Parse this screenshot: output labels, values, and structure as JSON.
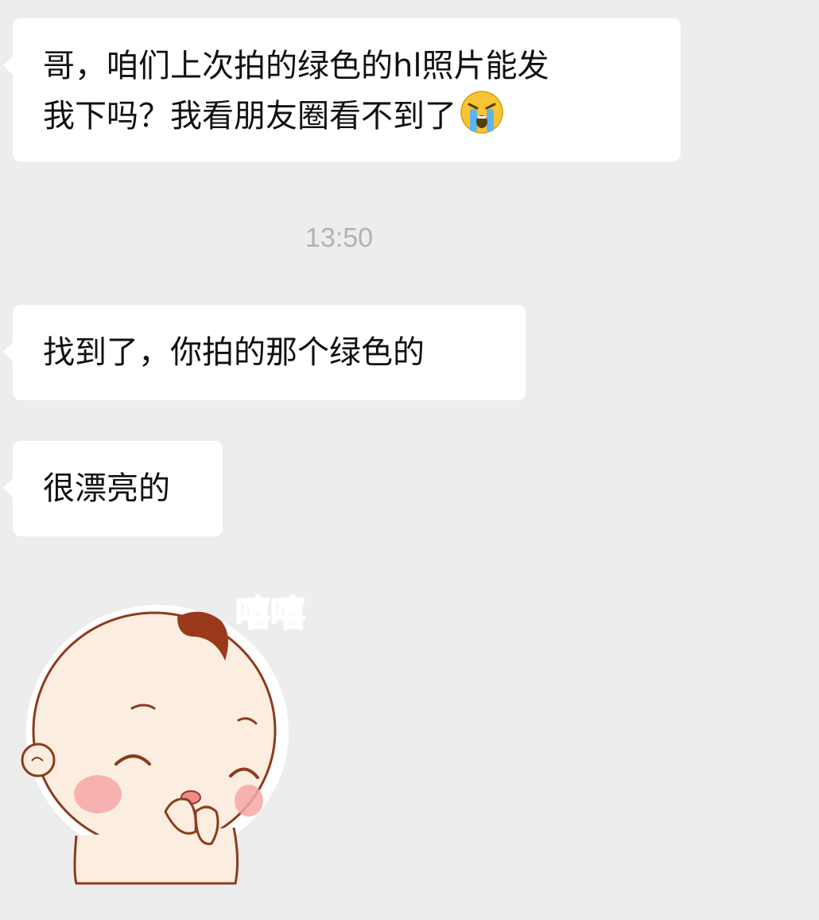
{
  "messages": [
    {
      "lines": [
        "哥，咱们上次拍的绿色的hl照片能发",
        "我下吗？我看朋友圈看不到了"
      ],
      "emoji": "crying-face-icon"
    },
    {
      "lines": [
        "找到了，你拍的那个绿色的"
      ]
    },
    {
      "lines": [
        "很漂亮的"
      ]
    }
  ],
  "timestamp": "13:50",
  "sticker": {
    "text": "嘻嘻",
    "icon": "giggling-baby-sticker"
  },
  "colors": {
    "background": "#ededed",
    "bubble": "#ffffff",
    "timestamp": "#b2b2b2",
    "sticker_text": "#f06a6a"
  }
}
